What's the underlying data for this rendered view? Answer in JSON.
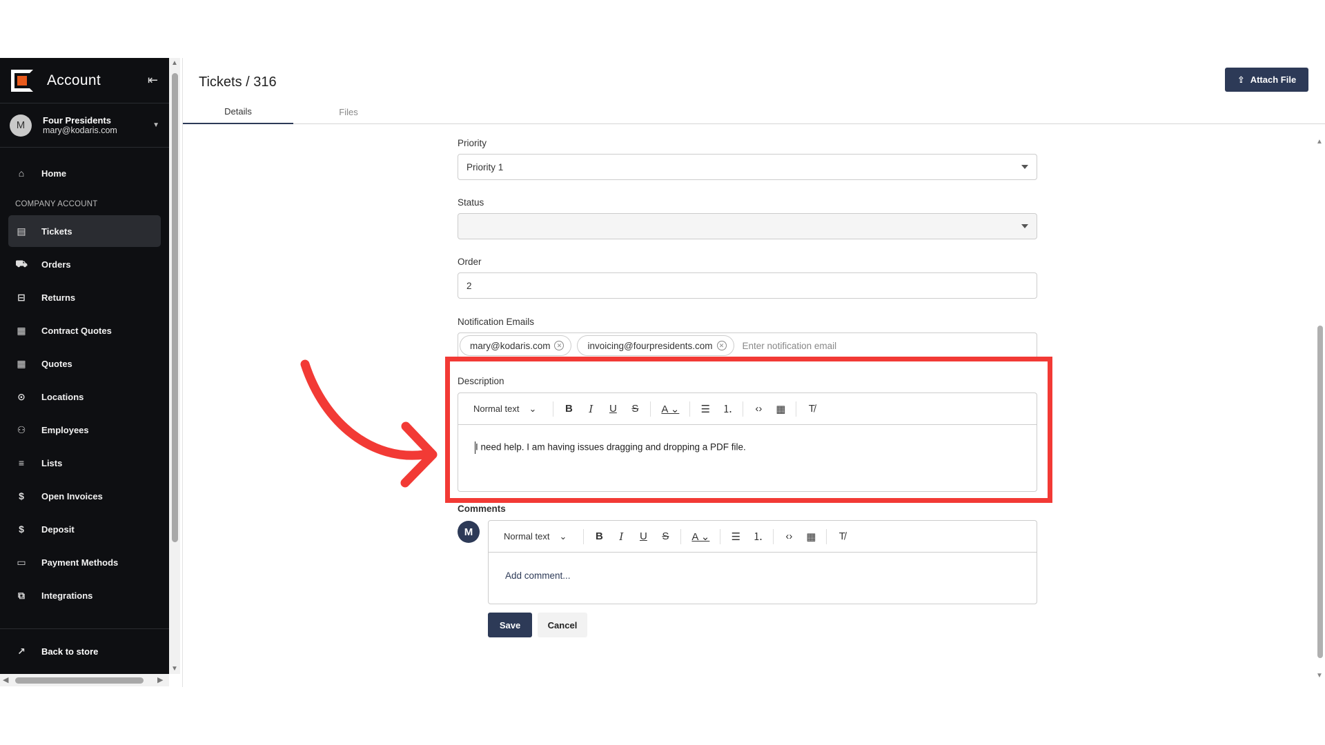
{
  "sidebar": {
    "title": "Account",
    "user": {
      "initial": "M",
      "name": "Four Presidents",
      "email": "mary@kodaris.com"
    },
    "home": "Home",
    "section_label": "COMPANY ACCOUNT",
    "items": [
      {
        "label": "Tickets",
        "icon": "ticket-icon",
        "active": true
      },
      {
        "label": "Orders",
        "icon": "truck-icon"
      },
      {
        "label": "Returns",
        "icon": "return-icon"
      },
      {
        "label": "Contract Quotes",
        "icon": "clipboard-icon"
      },
      {
        "label": "Quotes",
        "icon": "clipboard-icon"
      },
      {
        "label": "Locations",
        "icon": "location-pin-icon"
      },
      {
        "label": "Employees",
        "icon": "people-icon"
      },
      {
        "label": "Lists",
        "icon": "list-icon"
      },
      {
        "label": "Open Invoices",
        "icon": "dollar-icon"
      },
      {
        "label": "Deposit",
        "icon": "dollar-icon"
      },
      {
        "label": "Payment Methods",
        "icon": "card-icon"
      },
      {
        "label": "Integrations",
        "icon": "integration-icon"
      }
    ],
    "back": "Back to store"
  },
  "header": {
    "breadcrumb": "Tickets / 316",
    "attach_label": "Attach File"
  },
  "tabs": [
    "Details",
    "Files"
  ],
  "form": {
    "priority_label": "Priority",
    "priority_value": "Priority 1",
    "status_label": "Status",
    "status_value": "",
    "order_label": "Order",
    "order_value": "2",
    "emails_label": "Notification Emails",
    "emails": [
      "mary@kodaris.com",
      "invoicing@fourpresidents.com"
    ],
    "email_placeholder": "Enter notification email",
    "description_label": "Description",
    "description_text": "I need help. I am having issues dragging and dropping a PDF file.",
    "toolbar_style": "Normal text",
    "comments_label": "Comments",
    "comment_avatar": "M",
    "comment_placeholder": "Add comment...",
    "save_label": "Save",
    "cancel_label": "Cancel"
  },
  "colors": {
    "accent": "#2d3a57",
    "highlight": "#f23a35",
    "sidebar": "#0e0f12",
    "brand": "#e85a1c"
  }
}
